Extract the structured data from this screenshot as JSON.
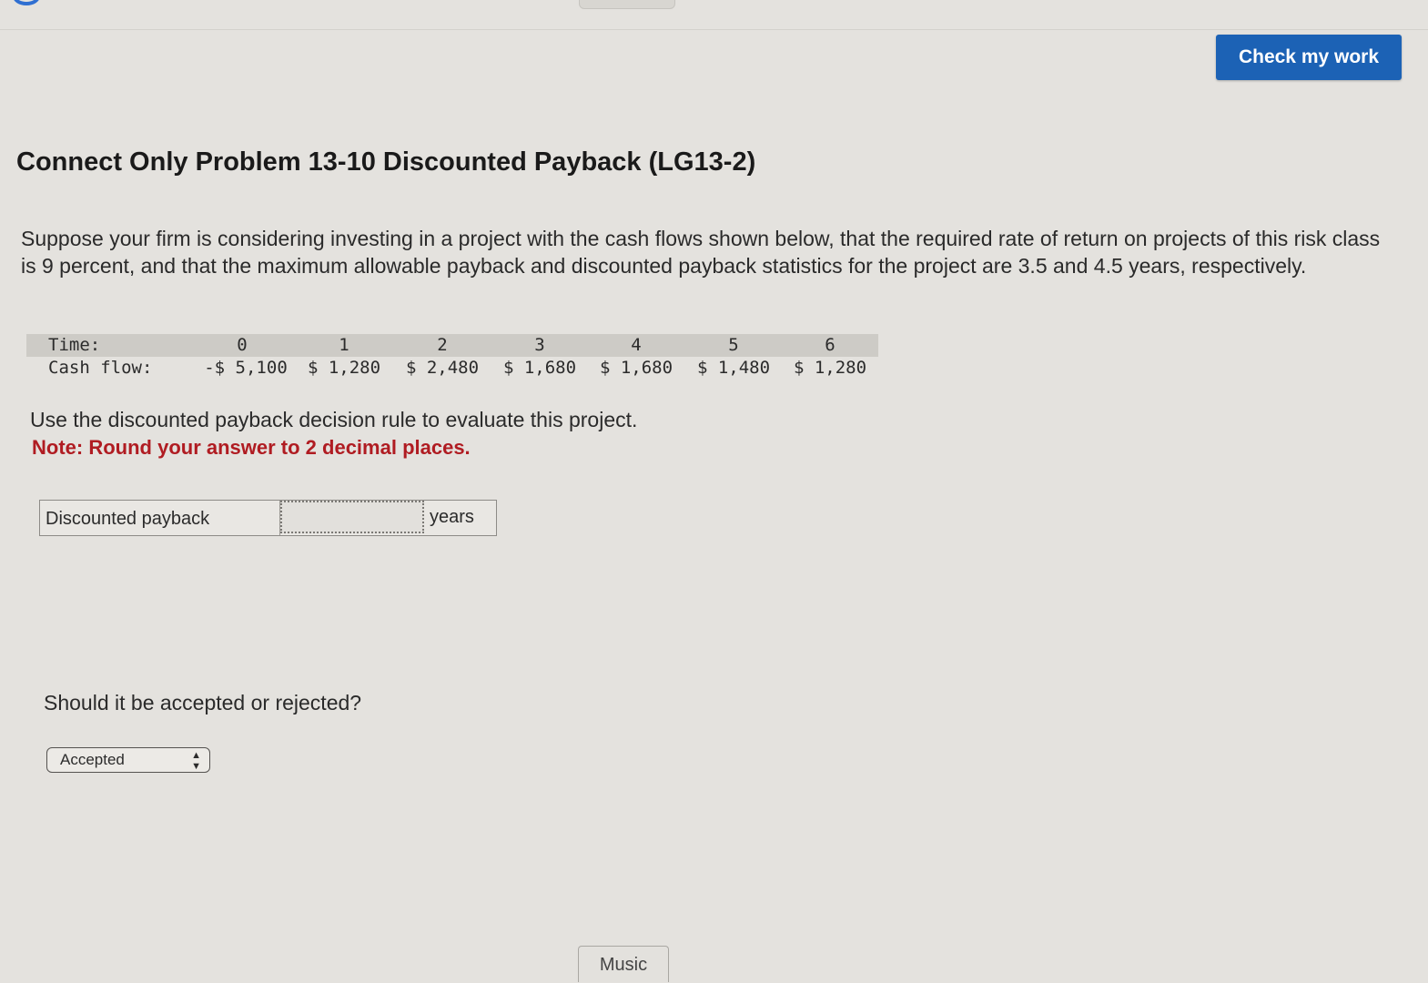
{
  "header": {
    "check_button_label": "Check my work"
  },
  "problem": {
    "title": "Connect Only Problem 13-10 Discounted Payback (LG13-2)",
    "description": "Suppose your firm is considering investing in a project with the cash flows shown below, that the required rate of return on projects of this risk class is 9 percent, and that the maximum allowable payback and discounted payback statistics for the project are 3.5 and 4.5 years, respectively."
  },
  "cash_flow_table": {
    "time_label": "Time:",
    "cash_flow_label": "Cash flow:",
    "times": [
      "0",
      "1",
      "2",
      "3",
      "4",
      "5",
      "6"
    ],
    "cash_flows": [
      "-$ 5,100",
      "$ 1,280",
      "$ 2,480",
      "$ 1,680",
      "$ 1,680",
      "$ 1,480",
      "$ 1,280"
    ]
  },
  "instructions": {
    "text": "Use the discounted payback decision rule to evaluate this project.",
    "note": "Note: Round your answer to 2 decimal places."
  },
  "answer": {
    "label": "Discounted payback",
    "value": "",
    "unit": "years"
  },
  "decision": {
    "question": "Should it be accepted or rejected?",
    "selected": "Accepted"
  },
  "footer": {
    "music_label": "Music"
  },
  "colors": {
    "button_blue": "#1c62b5",
    "note_red": "#b01c22"
  }
}
